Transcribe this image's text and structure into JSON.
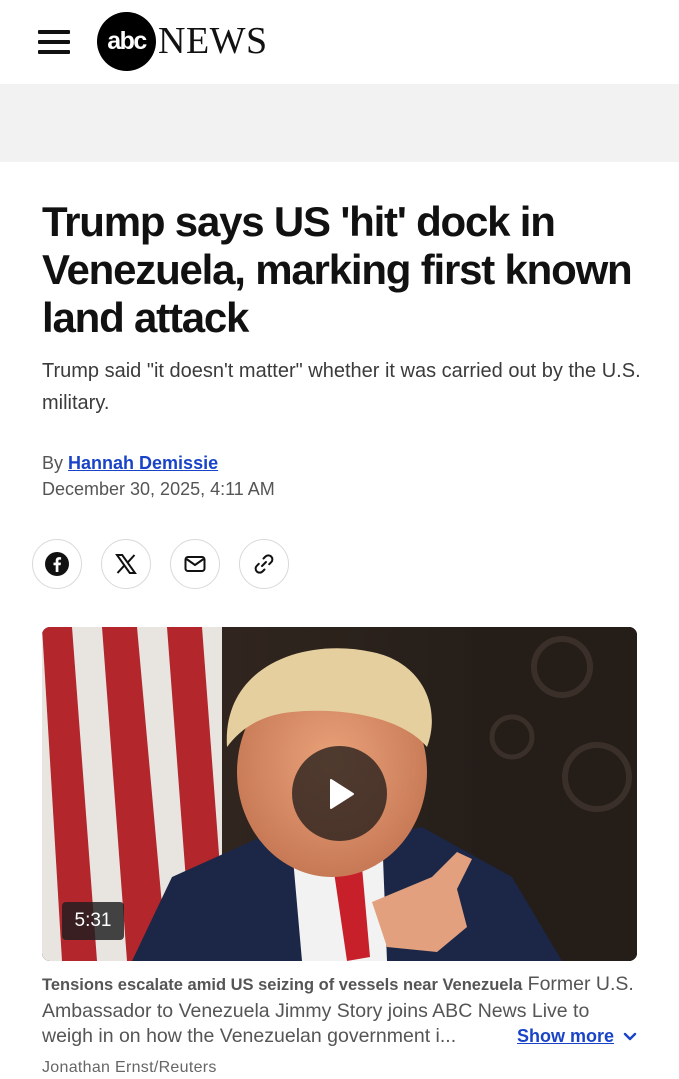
{
  "header": {
    "menu_icon": "hamburger-menu-icon",
    "logo_mark": "abc",
    "logo_text": "NEWS"
  },
  "article": {
    "headline": "Trump says US 'hit' dock in Venezuela, marking first known land attack",
    "subheadline": "Trump said \"it doesn't matter\" whether it was carried out by the U.S. military.",
    "byline_prefix": "By",
    "author": "Hannah Demissie",
    "date": "December 30, 2025, 4:11 AM"
  },
  "share": {
    "icons": [
      "facebook-icon",
      "x-icon",
      "email-icon",
      "link-icon"
    ]
  },
  "video": {
    "duration": "5:31",
    "play_icon": "play-icon",
    "caption_title": "Tensions escalate amid US seizing of vessels near Venezuela",
    "caption_text": "Former U.S. Ambassador to Venezuela Jimmy Story joins ABC News Live to weigh in on how the Venezuelan government i...",
    "show_more": "Show more",
    "credit": "Jonathan Ernst/Reuters"
  },
  "colors": {
    "link": "#1a44c8",
    "ad_band": "#f2f2f2"
  }
}
